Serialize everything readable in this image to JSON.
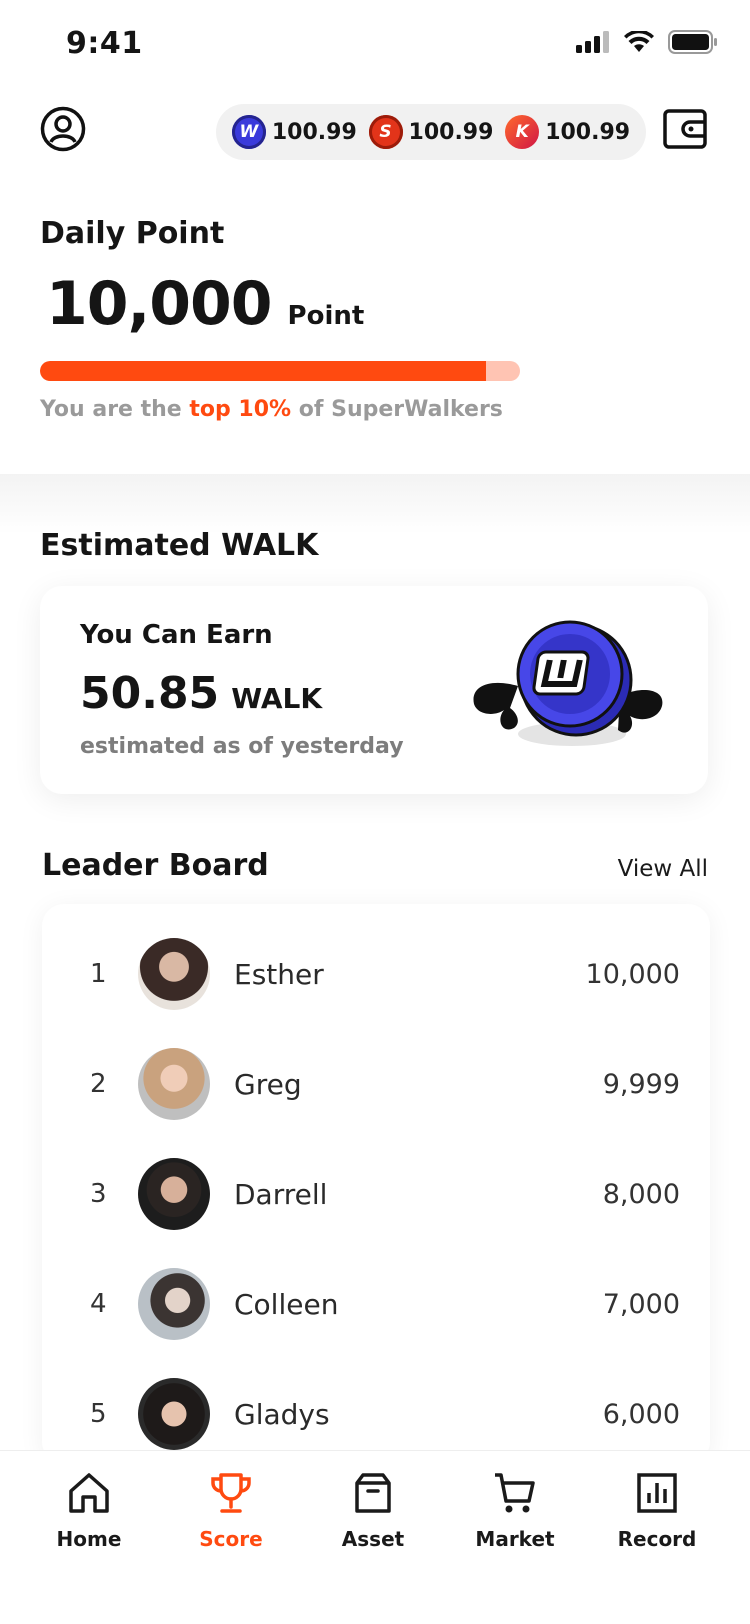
{
  "status_bar": {
    "time": "9:41"
  },
  "balances": [
    {
      "coin": "walk-coin-icon",
      "value": "100.99"
    },
    {
      "coin": "s-coin-icon",
      "value": "100.99"
    },
    {
      "coin": "k-coin-icon",
      "value": "100.99"
    }
  ],
  "daily": {
    "title": "Daily Point",
    "value": "10,000",
    "unit": "Point",
    "progress": 0.93,
    "rank_prefix": "You are the ",
    "rank_highlight": "top 10%",
    "rank_suffix": " of SuperWalkers"
  },
  "estimated": {
    "title": "Estimated WALK",
    "label": "You Can Earn",
    "value": "50.85",
    "unit": "WALK",
    "sub": "estimated as of yesterday"
  },
  "leaderboard": {
    "title": "Leader Board",
    "view_all": "View All",
    "rows": [
      {
        "rank": "1",
        "name": "Esther",
        "score": "10,000"
      },
      {
        "rank": "2",
        "name": "Greg",
        "score": "9,999"
      },
      {
        "rank": "3",
        "name": "Darrell",
        "score": "8,000"
      },
      {
        "rank": "4",
        "name": "Colleen",
        "score": "7,000"
      },
      {
        "rank": "5",
        "name": "Gladys",
        "score": "6,000"
      }
    ]
  },
  "tabs": [
    {
      "label": "Home",
      "icon": "home-icon",
      "active": false
    },
    {
      "label": "Score",
      "icon": "trophy-icon",
      "active": true
    },
    {
      "label": "Asset",
      "icon": "box-icon",
      "active": false
    },
    {
      "label": "Market",
      "icon": "cart-icon",
      "active": false
    },
    {
      "label": "Record",
      "icon": "chart-icon",
      "active": false
    }
  ],
  "colors": {
    "accent": "#ff4a10",
    "accent_light": "#ffc4b3",
    "walk_blue": "#3a3adb"
  }
}
